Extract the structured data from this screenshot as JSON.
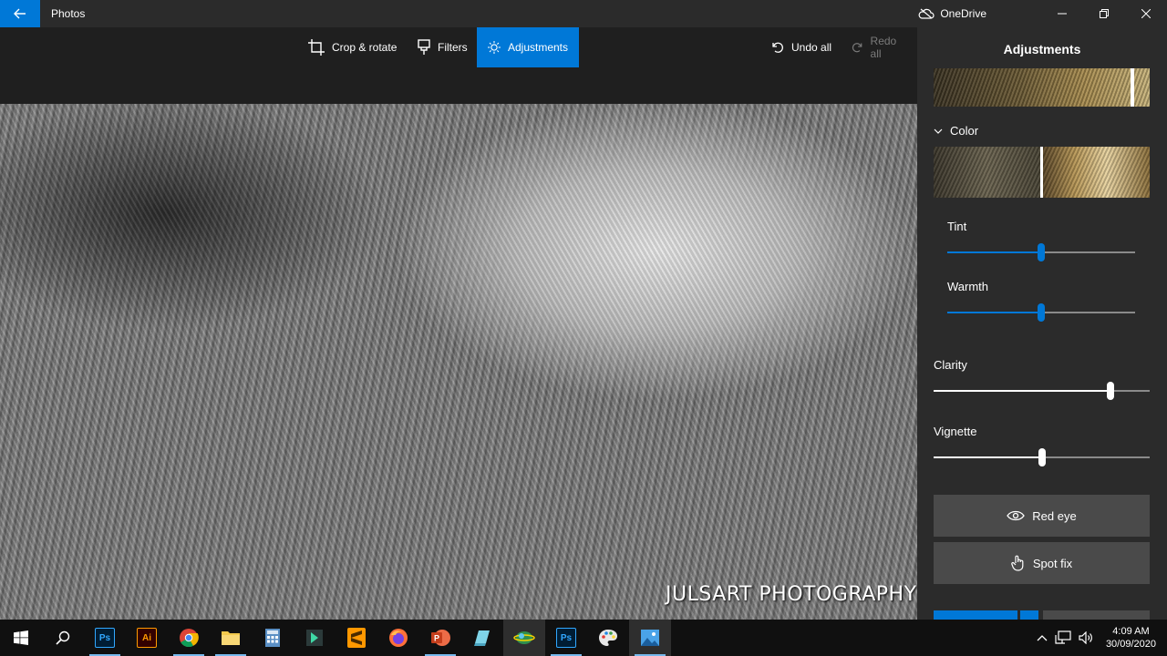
{
  "window": {
    "app_title": "Photos",
    "onedrive_label": "OneDrive"
  },
  "toolbar": {
    "crop_label": "Crop & rotate",
    "filters_label": "Filters",
    "adjustments_label": "Adjustments",
    "undo_label": "Undo all",
    "redo_label": "Redo all"
  },
  "image": {
    "watermark": "JULSART PHOTOGRAPHY"
  },
  "panel": {
    "title": "Adjustments",
    "light_thumb_position": 0.91,
    "color_section_label": "Color",
    "color_thumb_position": 0.5,
    "sliders": [
      {
        "label": "Tint",
        "value": 0.5,
        "sub": true
      },
      {
        "label": "Warmth",
        "value": 0.5,
        "sub": true
      },
      {
        "label": "Clarity",
        "value": 0.82,
        "sub": false
      },
      {
        "label": "Vignette",
        "value": 0.5,
        "sub": false
      }
    ],
    "red_eye_label": "Red eye",
    "spot_fix_label": "Spot fix"
  },
  "taskbar": {
    "time": "4:09 AM",
    "date": "30/09/2020",
    "apps": [
      "photoshop",
      "illustrator",
      "chrome",
      "file-explorer",
      "calculator",
      "app-green",
      "sublime-text",
      "firefox",
      "powerpoint",
      "app-notes",
      "globe-app",
      "photoshop-2",
      "paint-app",
      "photos"
    ]
  },
  "colors": {
    "accent": "#0078d7",
    "panel_bg": "#2b2b2b",
    "taskbar_bg": "#101010"
  }
}
